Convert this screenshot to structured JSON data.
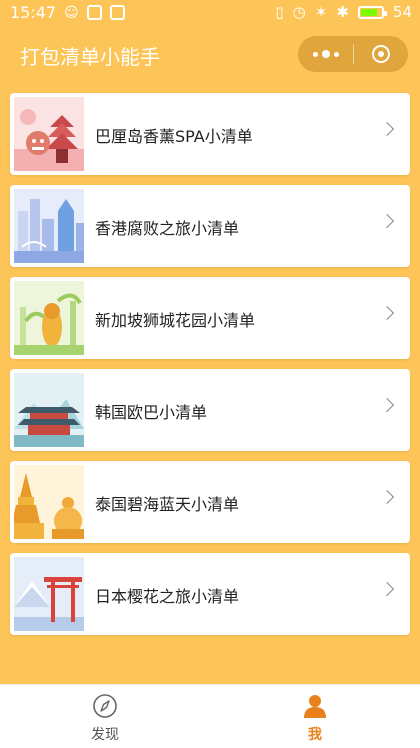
{
  "status_bar": {
    "time": "15:47",
    "battery_level": "54"
  },
  "header": {
    "title": "打包清单小能手"
  },
  "lists": [
    {
      "label": "巴厘岛香薰SPA小清单",
      "thumb_icon": "bali-temple-illustration",
      "accent": "#E86A6A"
    },
    {
      "label": "香港腐败之旅小清单",
      "thumb_icon": "hongkong-skyline-illustration",
      "accent": "#7FA9E8"
    },
    {
      "label": "新加坡狮城花园小清单",
      "thumb_icon": "singapore-merlion-illustration",
      "accent": "#9BCB5E"
    },
    {
      "label": "韩国欧巴小清单",
      "thumb_icon": "korea-palace-illustration",
      "accent": "#4FA3B8"
    },
    {
      "label": "泰国碧海蓝天小清单",
      "thumb_icon": "thailand-pagoda-illustration",
      "accent": "#F2A93B"
    },
    {
      "label": "日本樱花之旅小清单",
      "thumb_icon": "japan-torii-illustration",
      "accent": "#E2553C"
    }
  ],
  "tabs": [
    {
      "label": "发现",
      "icon": "compass-icon",
      "active": false
    },
    {
      "label": "我",
      "icon": "person-icon",
      "active": true
    }
  ],
  "colors": {
    "background": "#FDC458",
    "active_tab": "#E8801C"
  }
}
